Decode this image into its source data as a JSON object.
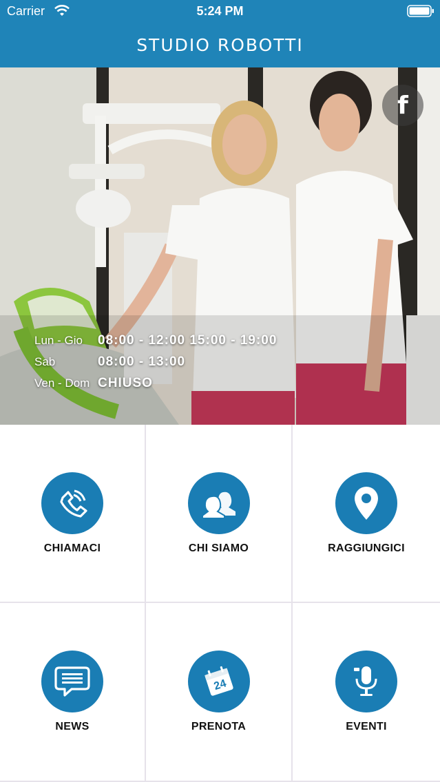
{
  "status_bar": {
    "carrier": "Carrier",
    "time": "5:24 PM"
  },
  "nav": {
    "title": "STUDIO ROBOTTI"
  },
  "hero": {
    "social_icon": "facebook-icon",
    "hours": [
      {
        "day": "Lun - Gio",
        "slot": "08:00 - 12:00 15:00 - 19:00"
      },
      {
        "day": "Sab",
        "slot": "08:00 - 13:00"
      },
      {
        "day": "Ven - Dom",
        "slot": "CHIUSO"
      }
    ]
  },
  "menu": [
    {
      "label": "CHIAMACI",
      "icon": "phone-icon"
    },
    {
      "label": "CHI SIAMO",
      "icon": "people-icon"
    },
    {
      "label": "RAGGIUNGICI",
      "icon": "map-pin-icon"
    },
    {
      "label": "NEWS",
      "icon": "chat-icon"
    },
    {
      "label": "PRENOTA",
      "icon": "calendar-icon"
    },
    {
      "label": "EVENTI",
      "icon": "microphone-icon"
    }
  ],
  "colors": {
    "brand": "#1f84b8",
    "icon_bg": "#1a7db4"
  }
}
